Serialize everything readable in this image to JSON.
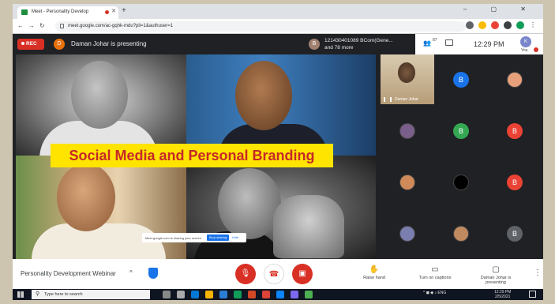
{
  "browser": {
    "tab_title": "Meet - Personality Develop",
    "address": "meet.google.com/ac-gqhk-mdu?pli=1&authuser=1",
    "controls": "–    ▢    ✕"
  },
  "meet_top": {
    "rec_label": "REC",
    "presenter_initial": "D",
    "presenter_text": "Daman Johar is presenting",
    "participant_initial": "B",
    "participant_name": "121430401089 BCom(Gene...",
    "participant_more": "and 78 more",
    "people_count": "87",
    "clock": "12:29 PM",
    "you_label": "You",
    "you_initial": "K"
  },
  "presentation": {
    "banner": "Social Media and Personal Branding",
    "toast_text": "Meet.google.com is sharing your screen",
    "toast_stop": "Stop sharing",
    "toast_hide": "Hide"
  },
  "grid": {
    "self_name": "Daman Johar",
    "tiles": [
      {
        "type": "avatar",
        "initial": "B",
        "color": "#1a73e8"
      },
      {
        "type": "photo",
        "color": "#e8a07a"
      },
      {
        "type": "photo",
        "color": "#7a5f8a"
      },
      {
        "type": "avatar",
        "initial": "B",
        "color": "#34a853"
      },
      {
        "type": "avatar",
        "initial": "B",
        "color": "#ea4335"
      },
      {
        "type": "photo",
        "color": "#d08a5a"
      },
      {
        "type": "photo",
        "color": "#000000"
      },
      {
        "type": "avatar",
        "initial": "B",
        "color": "#ea4335"
      },
      {
        "type": "photo",
        "color": "#7a7fb0"
      },
      {
        "type": "photo",
        "color": "#c08a60"
      },
      {
        "type": "avatar",
        "initial": "B",
        "color": "#5f6368"
      }
    ]
  },
  "controls": {
    "meeting_title": "Personality Development Webinar",
    "raise_hand": "Raise hand",
    "captions": "Turn on captions",
    "presenting": "Daman Johar is presenting",
    "more": "⋮"
  },
  "taskbar": {
    "search_placeholder": "Type here to search",
    "tray": "^  ◼  ◆  ♪  ENG",
    "time": "12:29 PM",
    "date": "2/5/2021",
    "region": "IN"
  },
  "colors": {
    "meet_dark": "#202124",
    "danger": "#d93025",
    "accent": "#1a73e8",
    "banner_bg": "#ffe400",
    "banner_text": "#c62828"
  }
}
